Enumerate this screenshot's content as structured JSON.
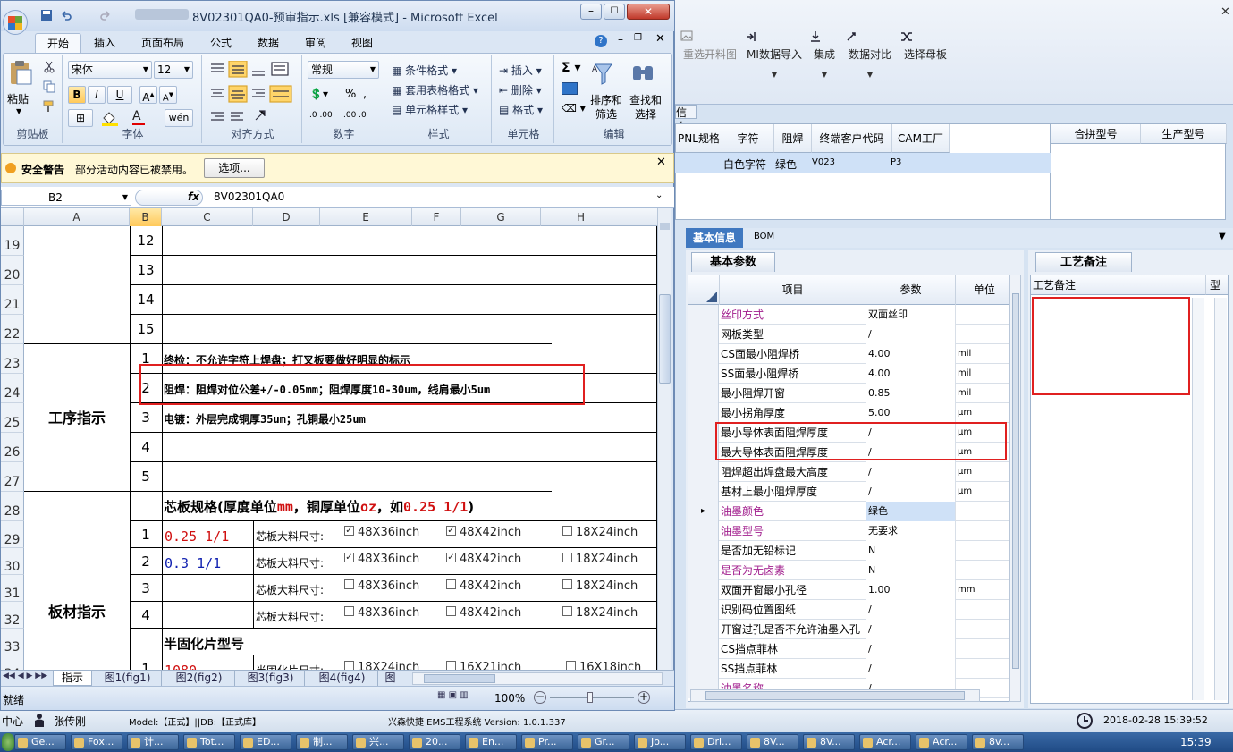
{
  "bg_app": {
    "toolbar": [
      {
        "label": "重选开料图"
      },
      {
        "label": "MI数据导入"
      },
      {
        "label": "集成"
      },
      {
        "label": "数据对比"
      },
      {
        "label": "选择母板"
      }
    ],
    "info_label": "信息",
    "grid1_headers": [
      "PNL规格",
      "字符",
      "阻焊",
      "终端客户代码",
      "CAM工厂"
    ],
    "grid1_row": [
      "",
      "白色字符",
      "绿色",
      "V023",
      "P3"
    ],
    "grid2_headers": [
      "合拼型号",
      "生产型号"
    ],
    "tabs": [
      "基本信息",
      "BOM"
    ],
    "basic_tab": "基本参数",
    "param_headers": [
      "项目",
      "参数",
      "单位"
    ],
    "params": [
      {
        "name": "丝印方式",
        "value": "双面丝印",
        "unit": "",
        "pink": true
      },
      {
        "name": "网板类型",
        "value": "/",
        "unit": "",
        "pink": false
      },
      {
        "name": "CS面最小阻焊桥",
        "value": "4.00",
        "unit": "mil",
        "pink": false
      },
      {
        "name": "SS面最小阻焊桥",
        "value": "4.00",
        "unit": "mil",
        "pink": false
      },
      {
        "name": "最小阻焊开窗",
        "value": "0.85",
        "unit": "mil",
        "pink": false
      },
      {
        "name": "最小拐角厚度",
        "value": "5.00",
        "unit": "μm",
        "pink": false
      },
      {
        "name": "最小导体表面阻焊厚度",
        "value": "/",
        "unit": "μm",
        "pink": false
      },
      {
        "name": "最大导体表面阻焊厚度",
        "value": "/",
        "unit": "μm",
        "pink": false
      },
      {
        "name": "阻焊超出焊盘最大高度",
        "value": "/",
        "unit": "μm",
        "pink": false
      },
      {
        "name": "基材上最小阻焊厚度",
        "value": "/",
        "unit": "μm",
        "pink": false
      },
      {
        "name": "油墨颜色",
        "value": "绿色",
        "unit": "",
        "pink": true
      },
      {
        "name": "油墨型号",
        "value": "无要求",
        "unit": "",
        "pink": true
      },
      {
        "name": "是否加无铅标记",
        "value": "N",
        "unit": "",
        "pink": false
      },
      {
        "name": "是否为无卤素",
        "value": "N",
        "unit": "",
        "pink": true
      },
      {
        "name": "双面开窗最小孔径",
        "value": "1.00",
        "unit": "mm",
        "pink": false
      },
      {
        "name": "识别码位置图纸",
        "value": "/",
        "unit": "",
        "pink": false
      },
      {
        "name": "开窗过孔是否不允许油墨入孔",
        "value": "/",
        "unit": "",
        "pink": false
      },
      {
        "name": "CS挡点菲林",
        "value": "/",
        "unit": "",
        "pink": false
      },
      {
        "name": "SS挡点菲林",
        "value": "/",
        "unit": "",
        "pink": false
      },
      {
        "name": "油墨名称",
        "value": "/",
        "unit": "",
        "pink": true
      }
    ],
    "craft_tab": "工艺备注",
    "craft_header": "工艺备注",
    "craft_col2": "型",
    "status": {
      "left": "中心",
      "user": "张传刚",
      "model": "Model:【正式】||DB:【正式库】",
      "system": "兴森快捷 EMS工程系统 Version: 1.0.1.337",
      "datetime": "2018-02-28 15:39:52"
    },
    "taskbar": [
      "Ge...",
      "Fox...",
      "计...",
      "Tot...",
      "ED...",
      "制...",
      "兴...",
      "20...",
      "En...",
      "Pr...",
      "Gr...",
      "Jo...",
      "Dri...",
      "8V...",
      "8V...",
      "Acr...",
      "Acr...",
      "8v..."
    ],
    "clock": "15:39"
  },
  "excel": {
    "title": "8V02301QA0-预审指示.xls  [兼容模式] - Microsoft Excel",
    "ribbon_tabs": [
      "开始",
      "插入",
      "页面布局",
      "公式",
      "数据",
      "审阅",
      "视图"
    ],
    "clipboard": {
      "paste": "粘贴",
      "label": "剪贴板"
    },
    "font": {
      "name": "宋体",
      "size": "12",
      "label": "字体"
    },
    "align_label": "对齐方式",
    "number": {
      "format": "常规",
      "label": "数字"
    },
    "styles": {
      "items": [
        "条件格式",
        "套用表格格式",
        "单元格样式"
      ],
      "label": "样式"
    },
    "cells": {
      "items": [
        "插入",
        "删除",
        "格式"
      ],
      "label": "单元格"
    },
    "editing": {
      "sort": "排序和\n筛选",
      "sort1": "排序和",
      "sort2": "筛选",
      "find1": "查找和",
      "find2": "选择",
      "label": "编辑"
    },
    "security": {
      "title": "安全警告",
      "msg": "部分活动内容已被禁用。",
      "btn": "选项..."
    },
    "namebox": "B2",
    "formula": "8V02301QA0",
    "columns": [
      "A",
      "B",
      "C",
      "D",
      "E",
      "F",
      "G",
      "H"
    ],
    "rows": [
      "19",
      "20",
      "21",
      "22",
      "23",
      "24",
      "25",
      "26",
      "27",
      "28",
      "29",
      "30",
      "31",
      "32",
      "33",
      "34"
    ],
    "b_values": [
      "12",
      "13",
      "14",
      "15",
      "1",
      "2",
      "3",
      "4",
      "5",
      "",
      "1",
      "2",
      "3",
      "4",
      "",
      "1"
    ],
    "merged_a1": "工序指示",
    "merged_a2": "板材指示",
    "process": [
      "终检：不允许字符上焊盘；打叉板要做好明显的标示",
      "阻焊：阻焊对位公差+/-0.05mm；阻焊厚度10-30um，线肩最小5um",
      "电镀：外层完成铜厚35um；孔铜最小25um"
    ],
    "core_title_a": "芯板规格(厚度单位",
    "core_title_b": "mm",
    "core_title_c": "，铜厚单位",
    "core_title_d": "oz",
    "core_title_e": "，如",
    "core_title_f": "0.25 1/1",
    "core_title_g": ")",
    "core_rows": [
      {
        "spec": "0.25 1/1",
        "color": "#d01010",
        "label": "芯板大料尺寸:",
        "opts": [
          "48X36inch",
          "48X42inch",
          "18X24inch"
        ],
        "checked": [
          true,
          true,
          false
        ]
      },
      {
        "spec": "0.3 1/1",
        "color": "#1020b0",
        "label": "芯板大料尺寸:",
        "opts": [
          "48X36inch",
          "48X42inch",
          "18X24inch"
        ],
        "checked": [
          true,
          true,
          false
        ]
      },
      {
        "spec": "",
        "color": "#000",
        "label": "芯板大料尺寸:",
        "opts": [
          "48X36inch",
          "48X42inch",
          "18X24inch"
        ],
        "checked": [
          false,
          false,
          false
        ]
      },
      {
        "spec": "",
        "color": "#000",
        "label": "芯板大料尺寸:",
        "opts": [
          "48X36inch",
          "48X42inch",
          "18X24inch"
        ],
        "checked": [
          false,
          false,
          false
        ]
      }
    ],
    "prepreg_title": "半固化片型号",
    "prepreg_row": {
      "spec": "1080",
      "label": "半固化片尺寸:",
      "opts": [
        "18X24inch",
        "16X21inch",
        "16X18inch"
      ]
    },
    "sheet_tabs": [
      "指示",
      "图1(fig1)",
      "图2(fig2)",
      "图3(fig3)",
      "图4(fig4)",
      "图"
    ],
    "status_left": "就绪",
    "zoom": "100%"
  }
}
